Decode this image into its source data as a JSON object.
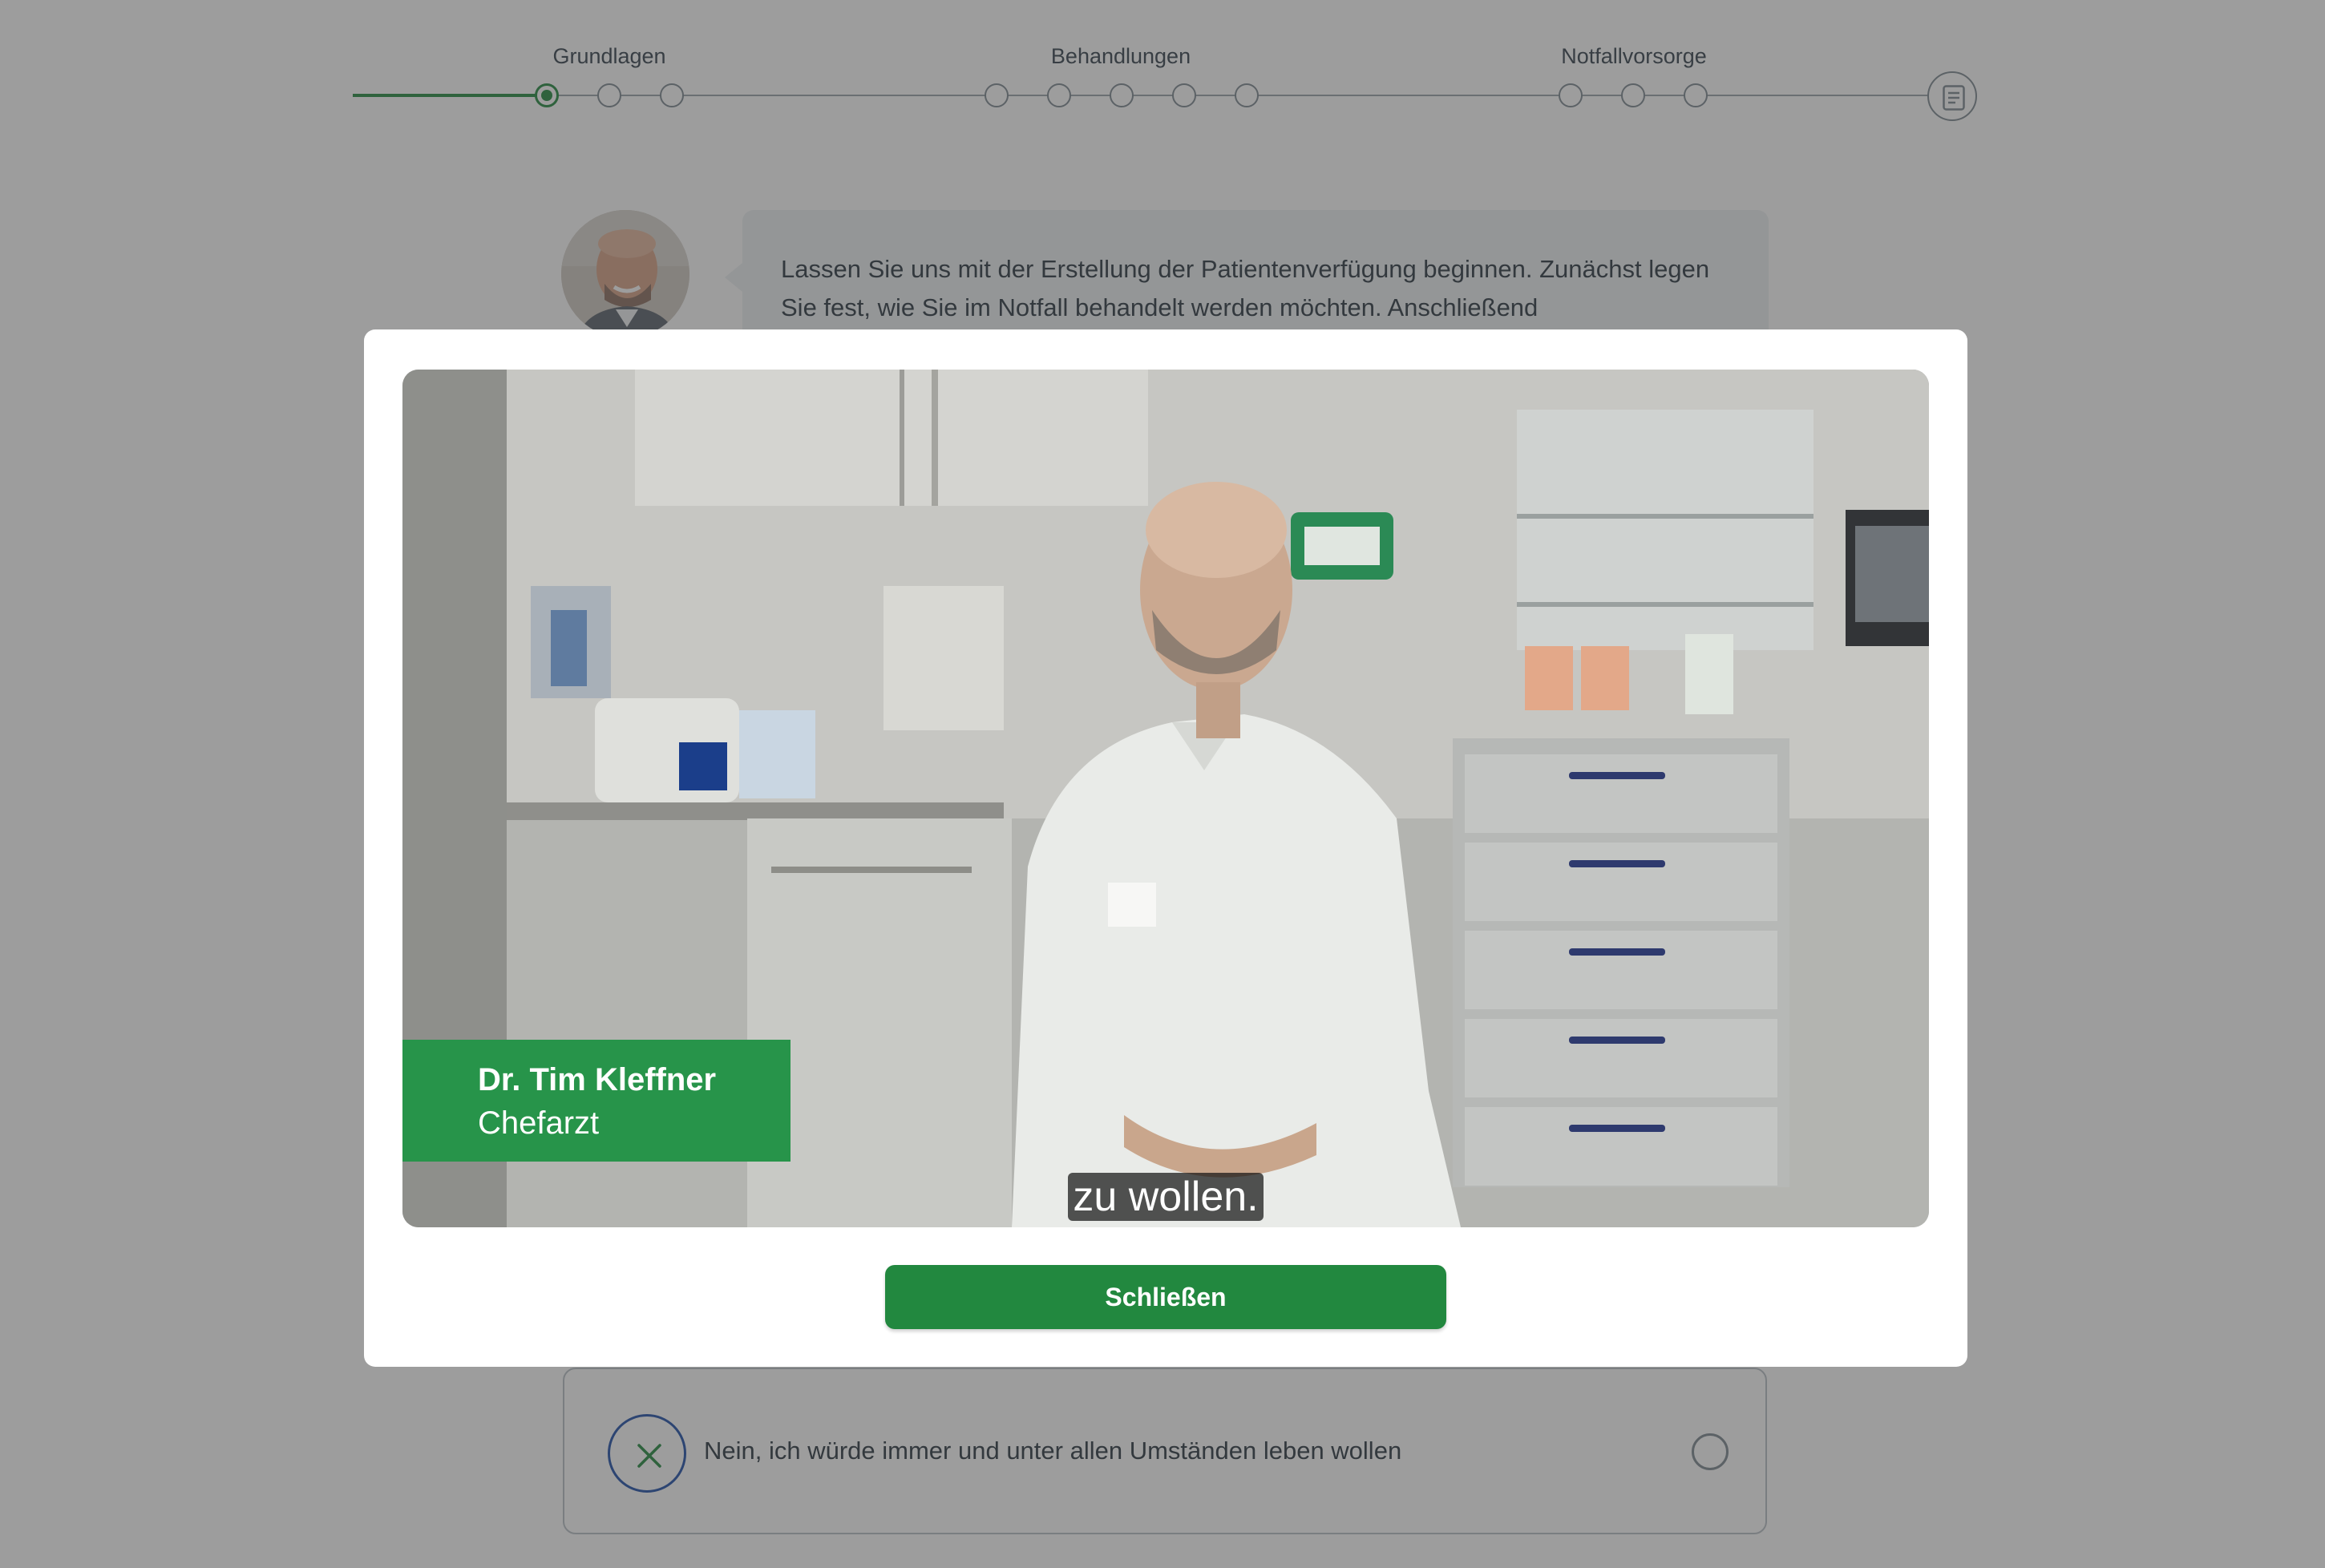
{
  "progress": {
    "steps": [
      {
        "label": "Grundlagen"
      },
      {
        "label": "Behandlungen"
      },
      {
        "label": "Notfallvorsorge"
      }
    ]
  },
  "advisor_message": {
    "text": "Lassen Sie uns mit der Erstellung der Patientenverfügung beginnen. Zunächst legen Sie fest, wie Sie im Notfall behandelt werden möchten. Anschließend"
  },
  "answer_option": {
    "icon": "close-icon",
    "text": "Nein, ich würde immer und unter allen Umständen leben wollen"
  },
  "video_modal": {
    "lower_third": {
      "name": "Dr. Tim Kleffner",
      "role": "Chefarzt"
    },
    "subtitle": "zu wollen.",
    "close_label": "Schließen"
  },
  "colors": {
    "accent": "#22883f",
    "lower_third": "#27944a",
    "overlay": "rgba(60,60,60,0.5)",
    "option_icon_ring": "#1f4fa8"
  }
}
